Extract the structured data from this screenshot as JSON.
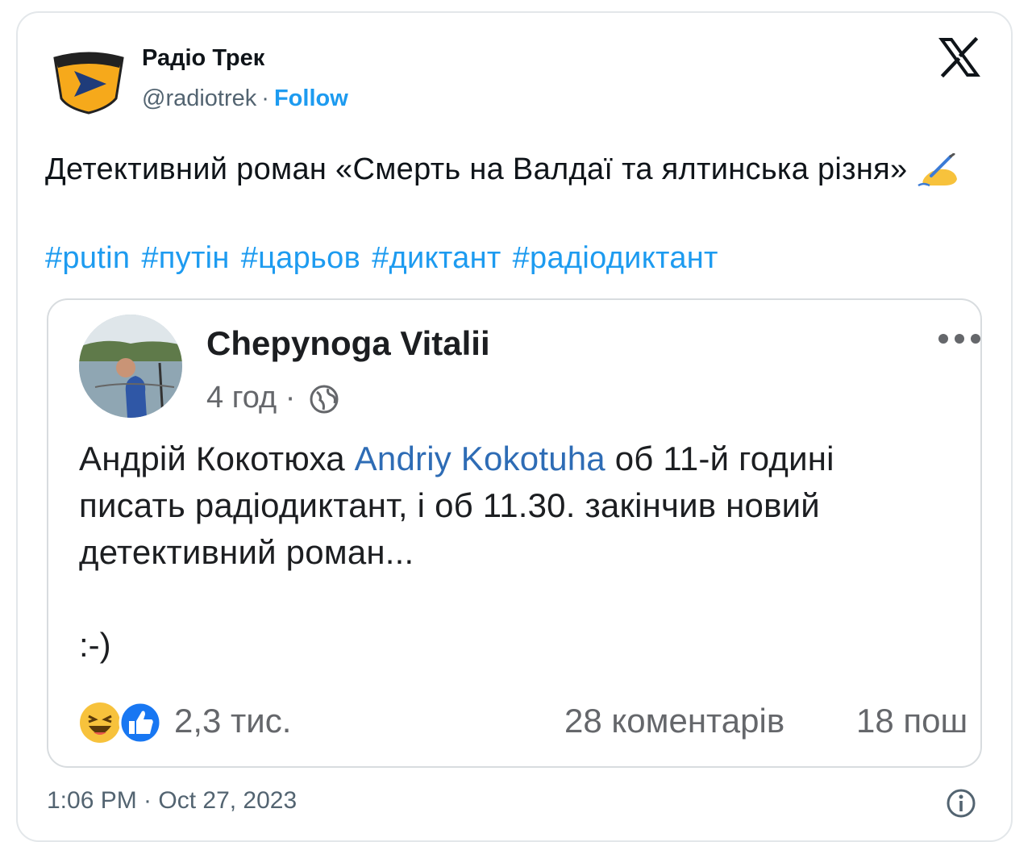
{
  "tweet": {
    "author_name": "Радіо Трек",
    "author_handle": "@radiotrek",
    "handle_separator": "·",
    "follow_label": "Follow",
    "text": "Детективний роман «Смерть на Валдаї та ялтинська різня»",
    "hashtags": [
      "#putin",
      "#путін",
      "#царьов",
      "#диктант",
      "#радіодиктант"
    ],
    "timestamp": "1:06 PM · Oct 27, 2023",
    "icons": {
      "logo": "radio-trek-logo",
      "platform": "x-logo",
      "emoji": "writing-hand-emoji",
      "info": "info-icon"
    }
  },
  "embedded_post": {
    "author_name": "Chepynoga Vitalii",
    "time": "4 год",
    "time_separator": "·",
    "body_before_mention": "Андрій Кокотюха ",
    "mention": "Andriy Kokotuha",
    "body_after_mention": " об 11-й годині\nписать радіодиктант, і об 11.30. закінчив новий\nдетективний роман...",
    "smiley": ":-)",
    "reactions_count": "2,3 тис.",
    "comments": "28 коментарів",
    "shares": "18 пош",
    "icons": {
      "audience": "globe-icon",
      "more": "more-dots-icon",
      "reactions": [
        "haha-reaction-icon",
        "like-reaction-icon"
      ]
    }
  },
  "colors": {
    "link": "#1d9bf0",
    "muted": "#536471",
    "mention": "#2e6cb5",
    "logo_yellow": "#f6a91b"
  }
}
